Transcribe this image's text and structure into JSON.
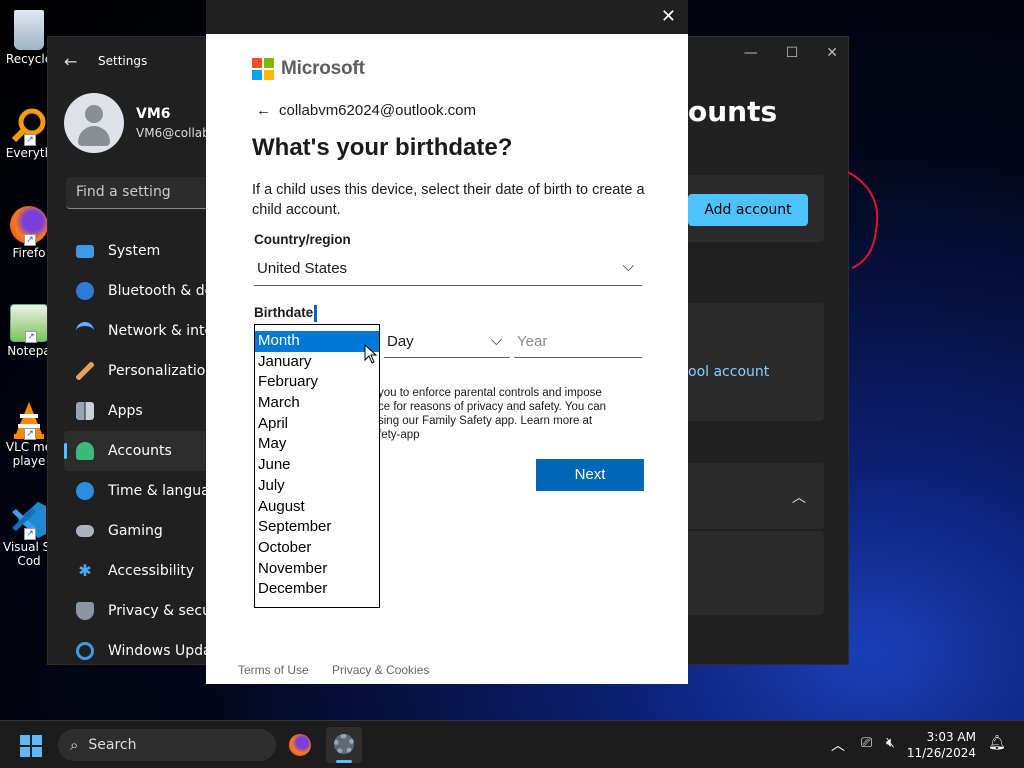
{
  "desktop": {
    "icons": [
      {
        "label": "Recycle",
        "name": "recycle-bin-icon"
      },
      {
        "label": "Everyth",
        "name": "everything-icon"
      },
      {
        "label": "Firefo",
        "name": "firefox-icon"
      },
      {
        "label": "Notepa",
        "name": "notepad-icon"
      },
      {
        "label": "VLC me",
        "label2": "playe",
        "name": "vlc-icon"
      },
      {
        "label": "Visual St",
        "label2": "Cod",
        "name": "vscode-icon"
      }
    ]
  },
  "settings": {
    "title": "Settings",
    "user_name": "VM6",
    "user_email": "VM6@collab",
    "search_placeholder": "Find a setting",
    "nav": [
      {
        "label": "System",
        "icon": "system-icon"
      },
      {
        "label": "Bluetooth & dev",
        "icon": "bluetooth-icon"
      },
      {
        "label": "Network & inter",
        "icon": "network-icon"
      },
      {
        "label": "Personalization",
        "icon": "brush-icon"
      },
      {
        "label": "Apps",
        "icon": "apps-icon"
      },
      {
        "label": "Accounts",
        "icon": "accounts-icon"
      },
      {
        "label": "Time & languag",
        "icon": "globe-icon"
      },
      {
        "label": "Gaming",
        "icon": "gamepad-icon"
      },
      {
        "label": "Accessibility",
        "icon": "accessibility-icon"
      },
      {
        "label": "Privacy & securi",
        "icon": "shield-icon"
      },
      {
        "label": "Windows Updat",
        "icon": "update-icon"
      }
    ],
    "page_title": "ounts",
    "add_account": "Add account",
    "school_account": "ool account"
  },
  "dialog": {
    "brand": "Microsoft",
    "email": "collabvm62024@outlook.com",
    "heading": "What's your birthdate?",
    "description": "If a child uses this device, select their date of birth to create a child account.",
    "country_label": "Country/region",
    "country_value": "United States",
    "birthdate_label": "Birthdate",
    "day_value": "Day",
    "year_placeholder": "Year",
    "legal_lines": [
      "you to enforce parental controls and impose",
      "ce for reasons of privacy and safety. You can",
      "sing our Family Safety app. Learn more at",
      "fety-app"
    ],
    "next": "Next",
    "footer_terms": "Terms of Use",
    "footer_privacy": "Privacy & Cookies",
    "months": [
      "Month",
      "January",
      "February",
      "March",
      "April",
      "May",
      "June",
      "July",
      "August",
      "September",
      "October",
      "November",
      "December"
    ],
    "selected_month": "Month"
  },
  "taskbar": {
    "search_label": "Search",
    "time": "3:03 AM",
    "date": "11/26/2024"
  },
  "colors": {
    "accent": "#0067b8",
    "settings_accent": "#4cc2ff",
    "list_highlight": "#0078d7"
  }
}
